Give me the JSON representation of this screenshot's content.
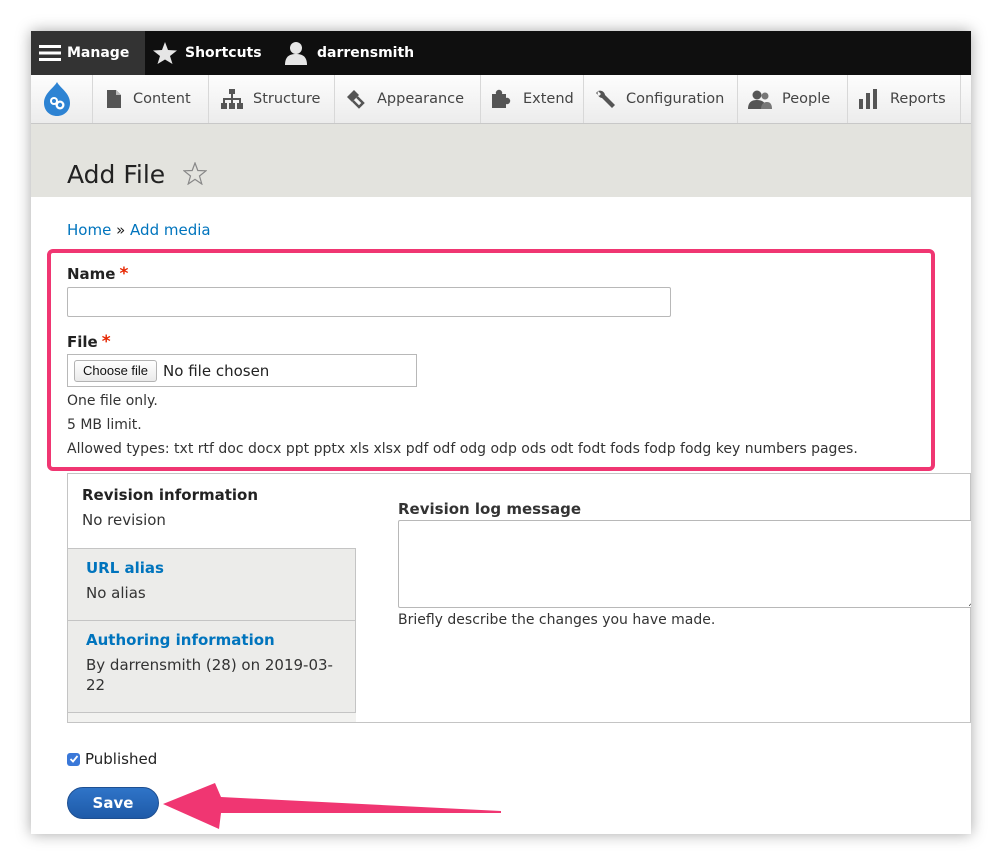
{
  "toolbar": {
    "manage_label": "Manage",
    "shortcuts_label": "Shortcuts",
    "user_label": "darrensmith"
  },
  "admin_menu": {
    "items": [
      {
        "label": "Content",
        "icon": "page-icon"
      },
      {
        "label": "Structure",
        "icon": "sitemap-icon"
      },
      {
        "label": "Appearance",
        "icon": "paintbrush-icon"
      },
      {
        "label": "Extend",
        "icon": "puzzle-icon"
      },
      {
        "label": "Configuration",
        "icon": "wrench-icon"
      },
      {
        "label": "People",
        "icon": "people-icon"
      },
      {
        "label": "Reports",
        "icon": "bar-chart-icon"
      }
    ]
  },
  "page": {
    "title": "Add File"
  },
  "breadcrumb": {
    "home": "Home",
    "separator": "»",
    "current": "Add media"
  },
  "form": {
    "name_label": "Name",
    "required_marker": "*",
    "name_value": "",
    "file_label": "File",
    "choose_file_label": "Choose file",
    "no_file_text": "No file chosen",
    "help_one_file": "One file only.",
    "help_limit": "5 MB limit.",
    "help_types": "Allowed types: txt rtf doc docx ppt pptx xls xlsx pdf odf odg odp ods odt fodt fods fodp fodg key numbers pages."
  },
  "vertical_tabs": {
    "revision_title": "Revision information",
    "revision_summary": "No revision",
    "url_title": "URL alias",
    "url_summary": "No alias",
    "authoring_title": "Authoring information",
    "authoring_summary": "By darrensmith (28) on 2019-03-22",
    "revlog_label": "Revision log message",
    "revlog_value": "",
    "revlog_help": "Briefly describe the changes you have made."
  },
  "published_label": "Published",
  "published_checked": true,
  "save_label": "Save",
  "colors": {
    "toolbar_bg": "#0f0f0f",
    "link": "#0074bd",
    "highlight_border": "#f03672",
    "arrow": "#f03672",
    "save_button": "#2f74c8",
    "required": "#e62600"
  }
}
